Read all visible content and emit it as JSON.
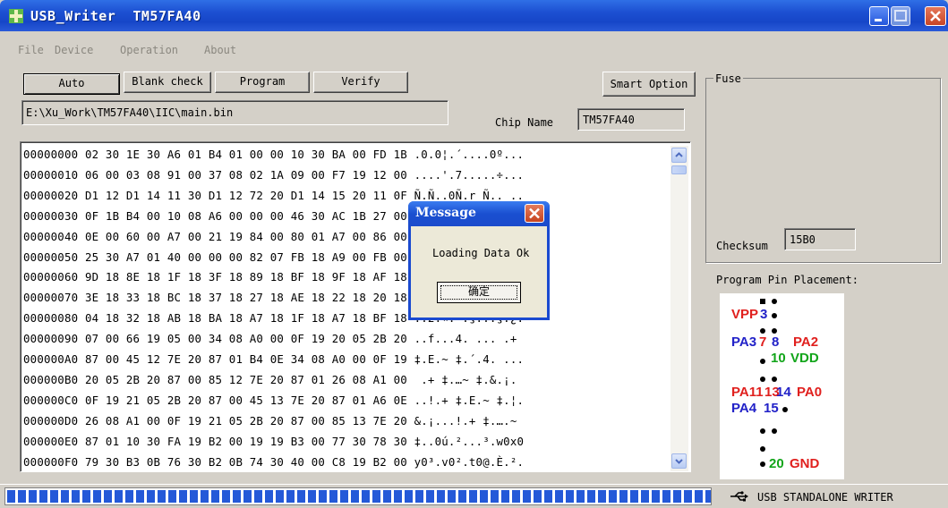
{
  "window": {
    "title": "USB_Writer  TM57FA40",
    "icon": "app-plus-icon"
  },
  "menu": [
    "File",
    "Device",
    "Operation",
    "About"
  ],
  "toolbar": {
    "auto": "Auto",
    "blank_check": "Blank check",
    "program": "Program",
    "verify": "Verify",
    "smart_option": "Smart Option"
  },
  "file_path": "E:\\Xu_Work\\TM57FA40\\IIC\\main.bin",
  "chip": {
    "label": "Chip Name",
    "value": "TM57FA40"
  },
  "hex_lines": [
    "00000000 02 30 1E 30 A6 01 B4 01 00 00 10 30 BA 00 FD 1B .0.0¦.´....0º...",
    "00000010 06 00 03 08 91 00 37 08 02 1A 09 00 F7 19 12 00 ....'.7.....÷...",
    "00000020 D1 12 D1 14 11 30 D1 12 72 20 D1 14 15 20 11 0F Ñ.Ñ..0Ñ.r Ñ.. ..",
    "00000030 0F 1B B4 00 10 08 A6 00 00 00 46 30 AC 1B 27 00 ..´...¦...F0¬.'.",
    "00000040 0E 00 60 00 A7 00 21 19 84 00 80 01 A7 00 86 00 ..`.§.!.„.€.§.†.",
    "00000050 25 30 A7 01 40 00 00 00 82 07 FB 18 A9 00 FB 00 %0§.@...‚.û.©.û.",
    "00000060 9D 18 8E 18 1F 18 3F 18 89 18 BF 18 9F 18 AF 18 ......?.‰.¿.Ÿ.¯.",
    "00000070 3E 18 33 18 BC 18 37 18 27 18 AE 18 22 18 20 18 >.3.¼.7.'.®.\". .",
    "00000080 04 18 32 18 AB 18 BA 18 A7 18 1F 18 A7 18 BF 18 ..2.«.º.§...§.¿.",
    "00000090 07 00 66 19 05 00 34 08 A0 00 0F 19 20 05 2B 20 ..f...4. ... .+ ",
    "000000A0 87 00 45 12 7E 20 87 01 B4 0E 34 08 A0 00 0F 19 ‡.E.~ ‡.´.4. ...",
    "000000B0 20 05 2B 20 87 00 85 12 7E 20 87 01 26 08 A1 00  .+ ‡.…~ ‡.&.¡.",
    "000000C0 0F 19 21 05 2B 20 87 00 45 13 7E 20 87 01 A6 0E ..!.+ ‡.E.~ ‡.¦.",
    "000000D0 26 08 A1 00 0F 19 21 05 2B 20 87 00 85 13 7E 20 &.¡...!.+ ‡.….~ ",
    "000000E0 87 01 10 30 FA 19 B2 00 19 19 B3 00 77 30 78 30 ‡..0ú.²...³.w0x0",
    "000000F0 79 30 B3 0B 76 30 B2 0B 74 30 40 00 C8 19 B2 00 y0³.v0².t0@.È.²."
  ],
  "fuse": {
    "label": "Fuse"
  },
  "checksum": {
    "label": "Checksum",
    "value": "15B0"
  },
  "pin_placement": {
    "label": "Program Pin Placement:",
    "vpp": "VPP",
    "vpp_num": "3",
    "pa3": "PA3",
    "pa3_num": "7",
    "pa2_num": "8",
    "pa2": "PA2",
    "vdd_num": "10",
    "vdd": "VDD",
    "pa11_label": "PA11",
    "pa11_num": "13",
    "pa0_num": "14",
    "pa0": "PA0",
    "pa4": "PA4",
    "pa4_num": "15",
    "gnd_num": "20",
    "gnd": "GND"
  },
  "dialog": {
    "title": "Message",
    "message": "Loading Data Ok",
    "ok": "确定"
  },
  "status": {
    "progress_fraction": 1.0,
    "text": "USB STANDALONE WRITER",
    "icon": "usb-icon"
  },
  "colors": {
    "pin_red": "#e0201e",
    "pin_blue": "#2222c8",
    "pin_green": "#12a51a",
    "progress": "#2459d8",
    "titlebar": "#1c4fd1"
  }
}
